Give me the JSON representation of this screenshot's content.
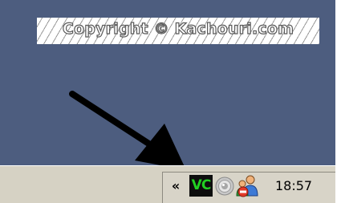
{
  "desktop": {
    "background_color": "#4d5d7f",
    "watermark_text": "Copyright © Kachouri.com",
    "pointer_icon": "arrow-icon"
  },
  "taskbar": {
    "background_color": "#d6d2c4",
    "tray": {
      "expand_label": "«",
      "icons": [
        {
          "name": "vc-app-icon",
          "text": "VC",
          "color": "#22d022"
        },
        {
          "name": "speaker-icon"
        },
        {
          "name": "network-connection-icon"
        }
      ],
      "clock": "18:57"
    }
  }
}
